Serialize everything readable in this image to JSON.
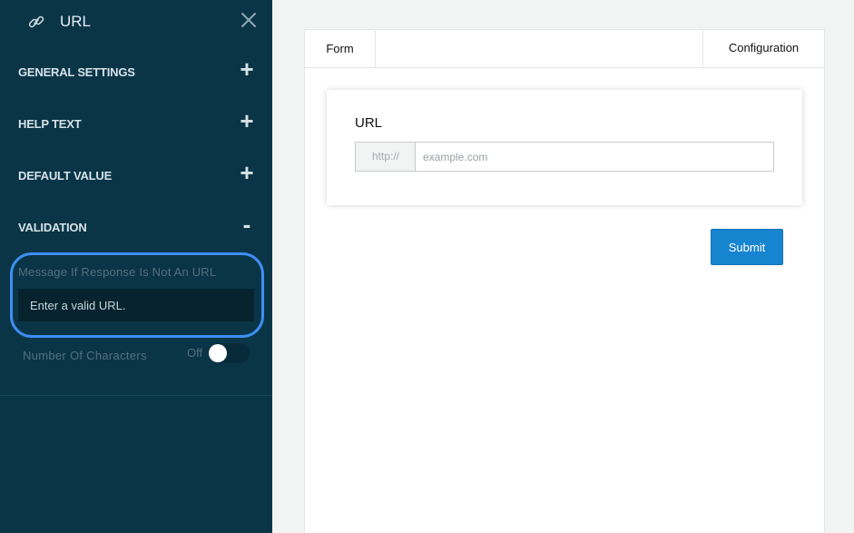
{
  "sidebar": {
    "title": "URL",
    "link_icon": "link-icon",
    "close_icon": "close-icon",
    "sections": [
      {
        "label": "GENERAL SETTINGS",
        "toggle": "+"
      },
      {
        "label": "HELP TEXT",
        "toggle": "+"
      },
      {
        "label": "DEFAULT VALUE",
        "toggle": "+"
      },
      {
        "label": "VALIDATION",
        "toggle": "-"
      }
    ],
    "validation": {
      "message_label": "Message If Response Is Not An URL",
      "message_value": "Enter a valid URL.",
      "chars_label": "Number Of Characters",
      "chars_toggle_state": "Off"
    }
  },
  "tabs": {
    "form": "Form",
    "configuration": "Configuration"
  },
  "form": {
    "field_label": "URL",
    "prefix": "http://",
    "placeholder": "example.com",
    "submit_label": "Submit"
  },
  "colors": {
    "sidebar_bg": "#0a3547",
    "accent_highlight": "#3e8ef2",
    "submit_bg": "#1784d0"
  }
}
